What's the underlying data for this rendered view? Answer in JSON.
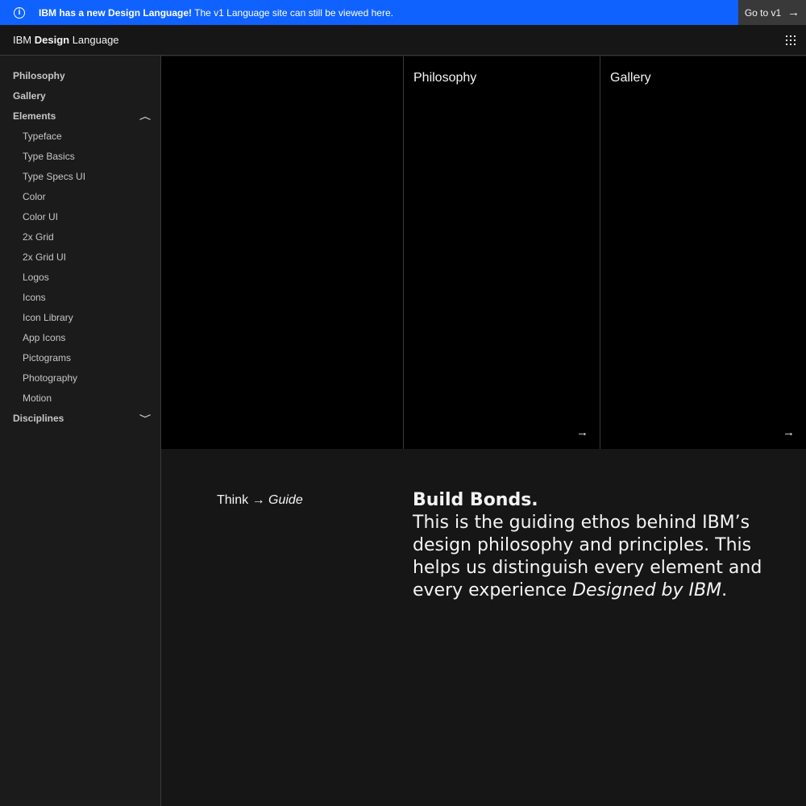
{
  "banner": {
    "icon": "info-icon",
    "title": "IBM has a new Design Language!",
    "text": " The v1 Language site can still be viewed here.",
    "button_label": "Go to v1",
    "button_icon": "arrow-right-icon",
    "background": "#0f62fe"
  },
  "header": {
    "brand_prefix": "IBM ",
    "brand_bold": "Design",
    "brand_suffix": " Language",
    "menu_icon": "grid-icon"
  },
  "sidebar": {
    "items": [
      {
        "label": "Philosophy"
      },
      {
        "label": "Gallery"
      },
      {
        "label": "Elements",
        "expanded": true
      },
      {
        "label": "Typeface"
      },
      {
        "label": "Type Basics"
      },
      {
        "label": "Type Specs UI"
      },
      {
        "label": "Color"
      },
      {
        "label": "Color UI"
      },
      {
        "label": "2x Grid"
      },
      {
        "label": "2x Grid UI"
      },
      {
        "label": "Logos"
      },
      {
        "label": "Icons"
      },
      {
        "label": "Icon Library"
      },
      {
        "label": "App Icons"
      },
      {
        "label": "Pictograms"
      },
      {
        "label": "Photography"
      },
      {
        "label": "Motion"
      },
      {
        "label": "Disciplines",
        "expanded": false
      }
    ]
  },
  "cards": [
    {
      "title": "Philosophy",
      "icon": "arrow-right-icon"
    },
    {
      "title": "Gallery",
      "icon": "arrow-right-icon"
    }
  ],
  "tagline": {
    "prefix": "Think → ",
    "emphasis": "Guide"
  },
  "ethos": {
    "title": "Build Bonds.",
    "body": "This is the guiding ethos behind IBM’s design philosophy and principles. This helps us distinguish every element and every experience ",
    "emphasis": "Designed by IBM",
    "end": "."
  }
}
